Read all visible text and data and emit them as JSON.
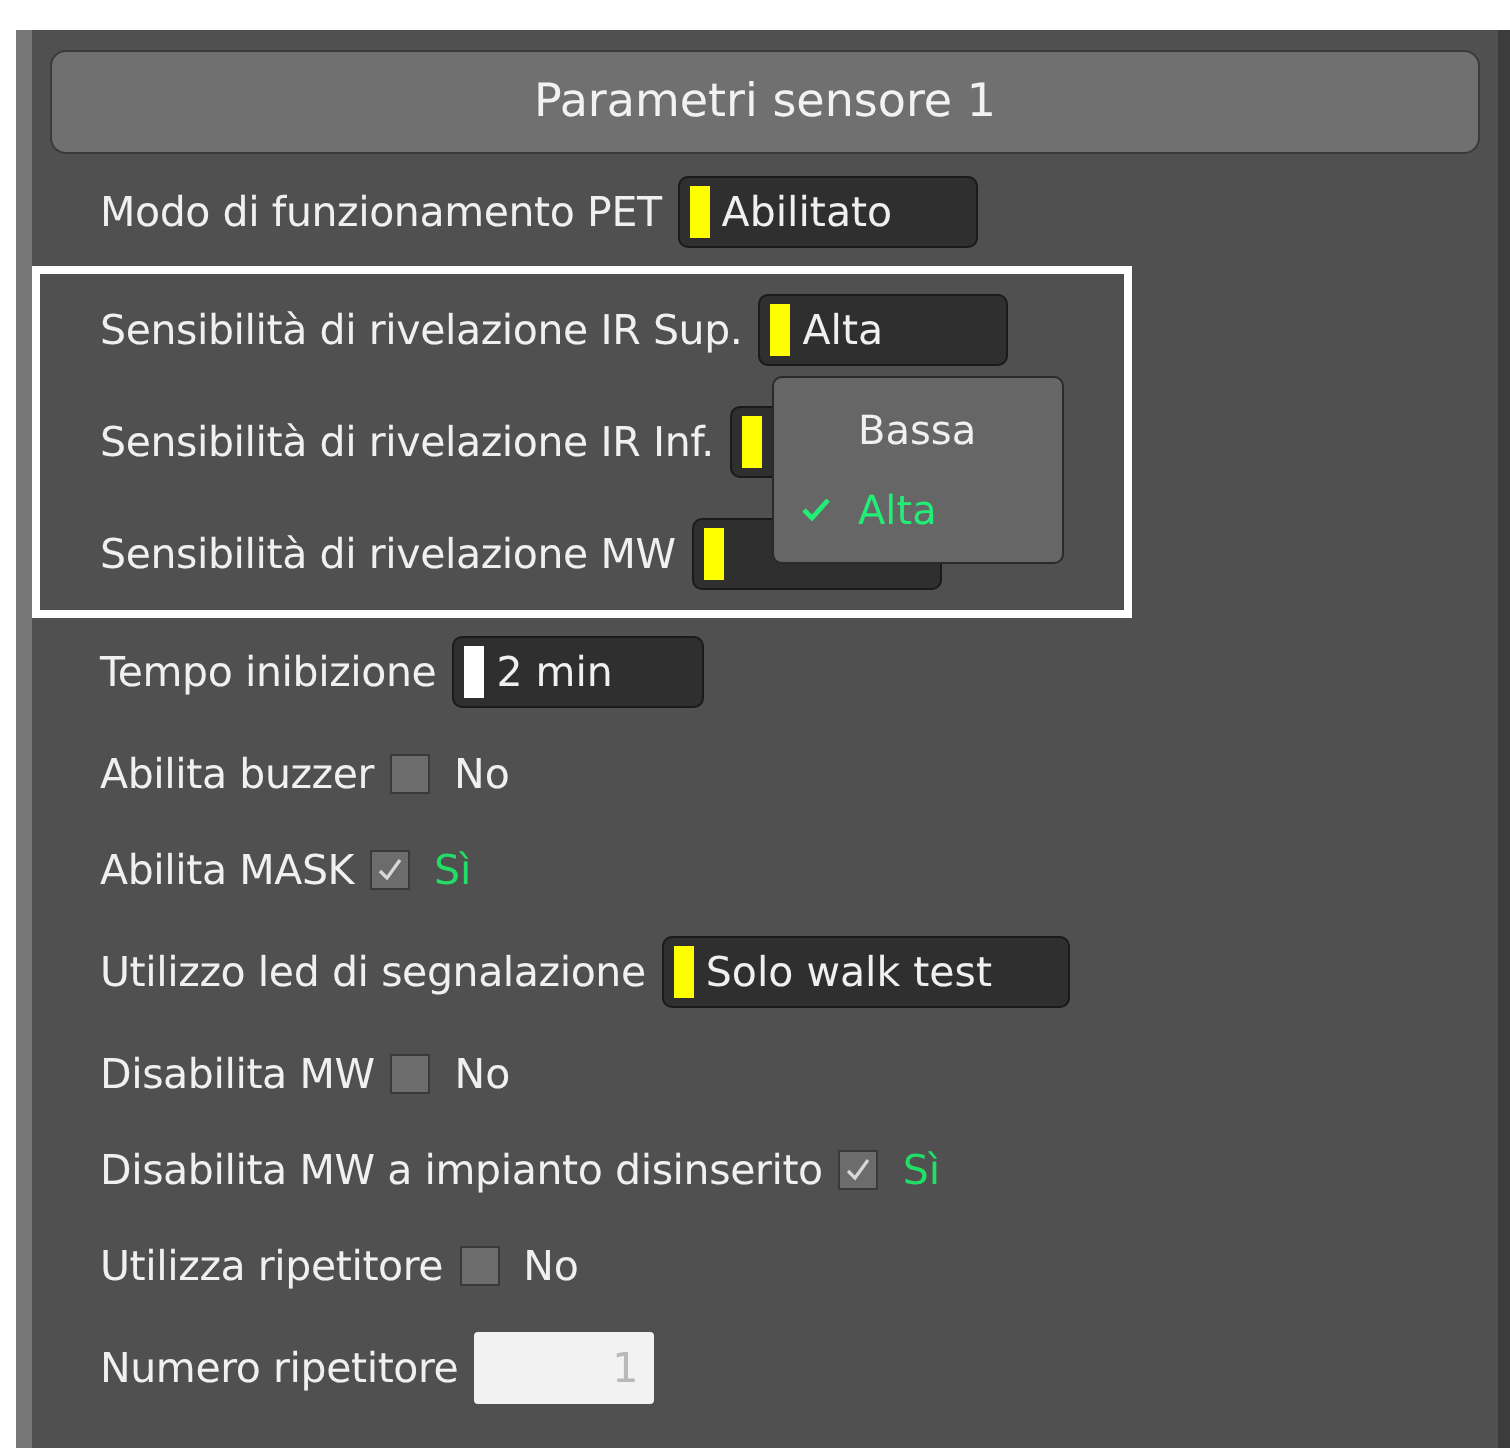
{
  "panel": {
    "title": "Parametri sensore 1"
  },
  "rows": [
    {
      "kind": "select",
      "label": "Modo di funzionamento PET",
      "value": "Abilitato",
      "color": "#ffff00"
    },
    {
      "kind": "select",
      "label": "Sensibilità di rivelazione IR Sup.",
      "value": "Alta",
      "color": "#ffff00",
      "highlighted": true,
      "dropdown": [
        {
          "label": "Bassa",
          "selected": false
        },
        {
          "label": "Alta",
          "selected": true
        }
      ]
    },
    {
      "kind": "select",
      "label": "Sensibilità di rivelazione IR Inf.",
      "color": "#ffff00",
      "highlighted": true
    },
    {
      "kind": "select",
      "label": "Sensibilità di rivelazione MW",
      "color": "#ffff00",
      "highlighted": true
    },
    {
      "kind": "select",
      "label": "Tempo inibizione",
      "value": "2 min",
      "color": "#ffffff"
    },
    {
      "kind": "checkbox",
      "label": "Abilita buzzer",
      "checked": false,
      "value": "No"
    },
    {
      "kind": "checkbox",
      "label": "Abilita MASK",
      "checked": true,
      "value": "Sì"
    },
    {
      "kind": "select",
      "label": "Utilizzo led di segnalazione",
      "value": "Solo walk test",
      "color": "#ffff00"
    },
    {
      "kind": "checkbox",
      "label": "Disabilita MW",
      "checked": false,
      "value": "No"
    },
    {
      "kind": "checkbox",
      "label": "Disabilita MW a impianto disinserito",
      "checked": true,
      "value": "Sì"
    },
    {
      "kind": "checkbox",
      "label": "Utilizza ripetitore",
      "checked": false,
      "value": "No"
    },
    {
      "kind": "number",
      "label": "Numero ripetitore",
      "value": "1"
    }
  ]
}
